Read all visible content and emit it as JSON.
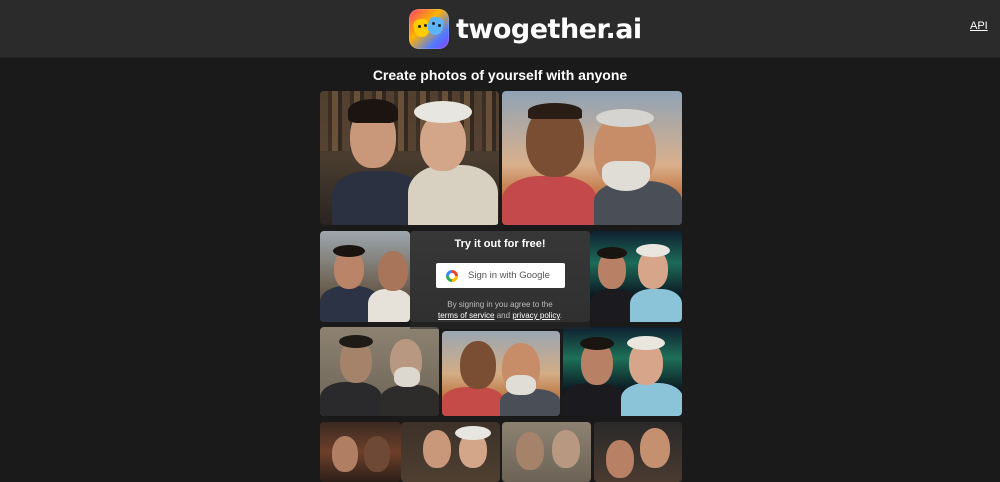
{
  "header": {
    "brand": "twogether.ai",
    "api_link": "API"
  },
  "main": {
    "headline": "Create photos of yourself with anyone",
    "signin_box": {
      "title": "Try it out for free!",
      "google_button": "Sign in with Google",
      "legal_prefix": "By signing in you agree to the",
      "terms_link": "terms of service",
      "and_text": "and",
      "privacy_link": "privacy policy",
      "period": "."
    }
  },
  "colors": {
    "page_background": "#1a1a1a",
    "header_background": "#2b2b2b",
    "button_background": "#ffffff"
  }
}
